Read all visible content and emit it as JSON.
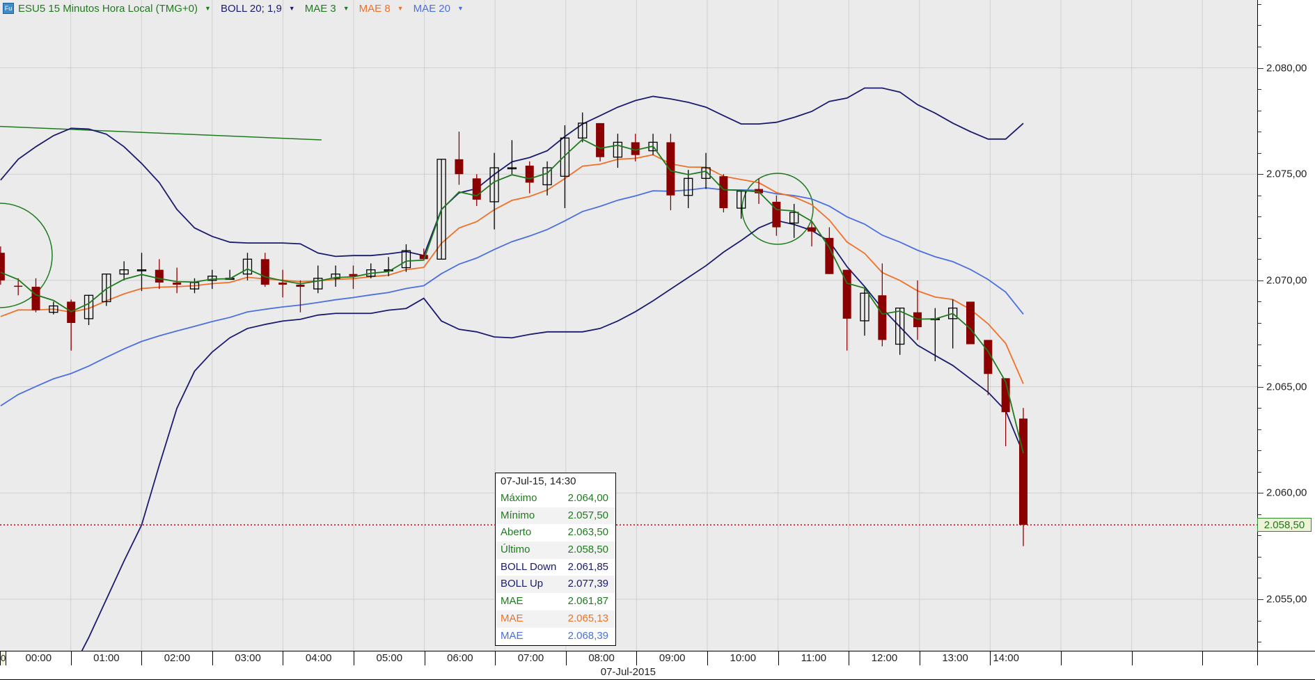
{
  "header": {
    "symbol": "ESU5 15 Minutos Hora Local (TMG+0)",
    "indicators": [
      {
        "label": "BOLL 20; 1,9",
        "color": "#1a1a6e"
      },
      {
        "label": "MAE 3",
        "color": "#1f7a1f"
      },
      {
        "label": "MAE 8",
        "color": "#f07028"
      },
      {
        "label": "MAE 20",
        "color": "#4a6fe0"
      }
    ],
    "logo_text": "Fu"
  },
  "price_axis": {
    "labels": [
      "2.080,00",
      "2.075,00",
      "2.070,00",
      "2.065,00",
      "2.060,00",
      "2.055,00"
    ],
    "values": [
      2080,
      2075,
      2070,
      2065,
      2060,
      2055
    ],
    "last_price": "2.058,50",
    "last_value": 2058.5
  },
  "time_axis": {
    "labels": [
      "00:00",
      "01:00",
      "02:00",
      "03:00",
      "04:00",
      "05:00",
      "06:00",
      "07:00",
      "08:00",
      "09:00",
      "10:00",
      "11:00",
      "12:00",
      "13:00",
      "14:00"
    ],
    "prev_label": "0",
    "date": "07-Jul-2015"
  },
  "tooltip": {
    "title": "07-Jul-15, 14:30",
    "rows": [
      {
        "label": "Máximo",
        "value": "2.064,00",
        "color": "#1f7a1f"
      },
      {
        "label": "Mínimo",
        "value": "2.057,50",
        "color": "#1f7a1f"
      },
      {
        "label": "Aberto",
        "value": "2.063,50",
        "color": "#1f7a1f"
      },
      {
        "label": "Último",
        "value": "2.058,50",
        "color": "#1f7a1f"
      },
      {
        "label": "BOLL Down",
        "value": "2.061,85",
        "color": "#1a1a6e"
      },
      {
        "label": "BOLL Up",
        "value": "2.077,39",
        "color": "#1a1a6e"
      },
      {
        "label": "MAE",
        "value": "2.061,87",
        "color": "#1f7a1f"
      },
      {
        "label": "MAE",
        "value": "2.065,13",
        "color": "#f07028"
      },
      {
        "label": "MAE",
        "value": "2.068,39",
        "color": "#4a6fe0"
      }
    ]
  },
  "chart_data": {
    "type": "candlestick",
    "interval_minutes": 15,
    "ylim": [
      2052,
      2083
    ],
    "candles_ohlc": [
      [
        2071.3,
        2071.6,
        2069.8,
        2070.0
      ],
      [
        2069.75,
        2070.1,
        2069.3,
        2069.7
      ],
      [
        2069.7,
        2070.1,
        2068.5,
        2068.6
      ],
      [
        2068.5,
        2069.0,
        2068.4,
        2068.8
      ],
      [
        2069.0,
        2069.1,
        2066.7,
        2068.0
      ],
      [
        2068.2,
        2069.3,
        2067.9,
        2069.3
      ],
      [
        2069.0,
        2070.3,
        2068.8,
        2070.3
      ],
      [
        2070.3,
        2070.9,
        2070.0,
        2070.5
      ],
      [
        2070.5,
        2071.3,
        2069.5,
        2070.5
      ],
      [
        2070.5,
        2071.0,
        2069.6,
        2069.9
      ],
      [
        2069.9,
        2070.6,
        2069.4,
        2069.8
      ],
      [
        2069.6,
        2070.1,
        2069.4,
        2069.9
      ],
      [
        2070.0,
        2070.5,
        2069.6,
        2070.2
      ],
      [
        2070.1,
        2070.5,
        2070.1,
        2070.1
      ],
      [
        2070.3,
        2071.3,
        2070.0,
        2071.0
      ],
      [
        2071.0,
        2071.3,
        2069.7,
        2069.8
      ],
      [
        2069.9,
        2070.5,
        2069.2,
        2069.8
      ],
      [
        2069.8,
        2070.0,
        2068.5,
        2069.7
      ],
      [
        2069.6,
        2070.7,
        2069.4,
        2070.1
      ],
      [
        2070.1,
        2070.7,
        2069.7,
        2070.3
      ],
      [
        2070.3,
        2070.7,
        2069.6,
        2070.2
      ],
      [
        2070.2,
        2070.8,
        2070.1,
        2070.5
      ],
      [
        2070.5,
        2071.1,
        2070.2,
        2070.5
      ],
      [
        2070.6,
        2071.7,
        2070.4,
        2071.4
      ],
      [
        2071.2,
        2071.5,
        2071.0,
        2071.0
      ],
      [
        2071.0,
        2075.7,
        2071.0,
        2075.7
      ],
      [
        2075.7,
        2077.0,
        2074.5,
        2075.0
      ],
      [
        2074.8,
        2075.0,
        2073.5,
        2073.8
      ],
      [
        2073.7,
        2076.0,
        2072.4,
        2075.3
      ],
      [
        2075.3,
        2076.6,
        2075.0,
        2075.3
      ],
      [
        2075.4,
        2075.6,
        2074.1,
        2074.6
      ],
      [
        2074.5,
        2075.6,
        2074.0,
        2075.3
      ],
      [
        2074.9,
        2077.3,
        2073.4,
        2076.7
      ],
      [
        2076.7,
        2077.9,
        2076.5,
        2077.4
      ],
      [
        2077.4,
        2077.4,
        2075.6,
        2075.8
      ],
      [
        2075.8,
        2076.9,
        2075.3,
        2076.5
      ],
      [
        2076.5,
        2076.9,
        2075.6,
        2075.9
      ],
      [
        2076.1,
        2076.9,
        2075.9,
        2076.5
      ],
      [
        2076.5,
        2076.9,
        2073.3,
        2074.0
      ],
      [
        2074.0,
        2075.2,
        2073.4,
        2074.8
      ],
      [
        2074.8,
        2076.0,
        2074.3,
        2075.3
      ],
      [
        2074.9,
        2075.0,
        2073.2,
        2073.4
      ],
      [
        2073.4,
        2074.2,
        2072.9,
        2074.2
      ],
      [
        2074.3,
        2074.8,
        2073.6,
        2074.1
      ],
      [
        2073.7,
        2074.0,
        2072.1,
        2072.5
      ],
      [
        2072.7,
        2073.6,
        2072.0,
        2073.2
      ],
      [
        2072.5,
        2072.8,
        2071.6,
        2072.3
      ],
      [
        2072.0,
        2072.5,
        2070.3,
        2070.3
      ],
      [
        2070.5,
        2070.5,
        2066.7,
        2068.2
      ],
      [
        2068.1,
        2069.6,
        2067.4,
        2069.4
      ],
      [
        2069.3,
        2070.8,
        2066.9,
        2067.2
      ],
      [
        2067.0,
        2068.7,
        2066.5,
        2068.7
      ],
      [
        2068.5,
        2070.0,
        2067.2,
        2067.8
      ],
      [
        2068.2,
        2068.7,
        2066.2,
        2068.2
      ],
      [
        2068.2,
        2069.1,
        2066.8,
        2068.7
      ],
      [
        2069.0,
        2069.0,
        2067.0,
        2067.0
      ],
      [
        2067.2,
        2067.2,
        2064.6,
        2065.6
      ],
      [
        2065.4,
        2065.4,
        2062.2,
        2063.8
      ],
      [
        2063.5,
        2064.0,
        2057.5,
        2058.5
      ]
    ],
    "boll_up": [
      2074.72,
      2075.7,
      2076.29,
      2076.81,
      2077.16,
      2077.12,
      2076.88,
      2076.29,
      2075.5,
      2074.6,
      2073.34,
      2072.47,
      2072.07,
      2071.8,
      2071.76,
      2071.76,
      2071.76,
      2071.72,
      2071.29,
      2071.13,
      2071.17,
      2071.17,
      2071.25,
      2071.36,
      2071.17,
      2073.34,
      2074.12,
      2074.32,
      2074.99,
      2075.58,
      2075.78,
      2076.1,
      2076.77,
      2077.36,
      2077.75,
      2078.15,
      2078.46,
      2078.66,
      2078.54,
      2078.38,
      2078.15,
      2077.75,
      2077.36,
      2077.36,
      2077.44,
      2077.67,
      2077.95,
      2078.42,
      2078.58,
      2079.05,
      2079.05,
      2078.86,
      2078.27,
      2077.87,
      2077.4,
      2077.0,
      2076.65,
      2076.65,
      2077.39
    ],
    "boll_down": [
      2043,
      2045.5,
      2048,
      2050,
      2051.6,
      2053.2,
      2055.0,
      2056.8,
      2058.5,
      2061.31,
      2063.99,
      2065.73,
      2066.63,
      2067.3,
      2067.74,
      2067.93,
      2068.09,
      2068.17,
      2068.37,
      2068.45,
      2068.45,
      2068.45,
      2068.6,
      2068.68,
      2069.16,
      2068.09,
      2067.7,
      2067.58,
      2067.34,
      2067.3,
      2067.46,
      2067.58,
      2067.58,
      2067.58,
      2067.74,
      2068.09,
      2068.53,
      2069.04,
      2069.59,
      2070.14,
      2070.69,
      2071.33,
      2071.88,
      2072.47,
      2072.82,
      2072.63,
      2072.35,
      2071.84,
      2070.65,
      2069.71,
      2068.68,
      2067.82,
      2066.95,
      2066.47,
      2066.0,
      2065.37,
      2064.74,
      2063.87,
      2061.85
    ],
    "mae_periods": [
      3,
      8,
      20
    ],
    "mae_seeds": [
      2070.38,
      2068.3,
      2064.1
    ],
    "trendline": {
      "from": [
        -1,
        2077.28
      ],
      "to": [
        18.2,
        2076.61
      ]
    },
    "colors": {
      "down": "#8b0000",
      "up_outline": "#000000",
      "boll": "#1a1a6e",
      "mae3": "#1f7a1f",
      "mae8": "#f07028",
      "mae20": "#4a6fe0",
      "last_line": "#cc0000",
      "grid": "#cfcfcf"
    }
  }
}
